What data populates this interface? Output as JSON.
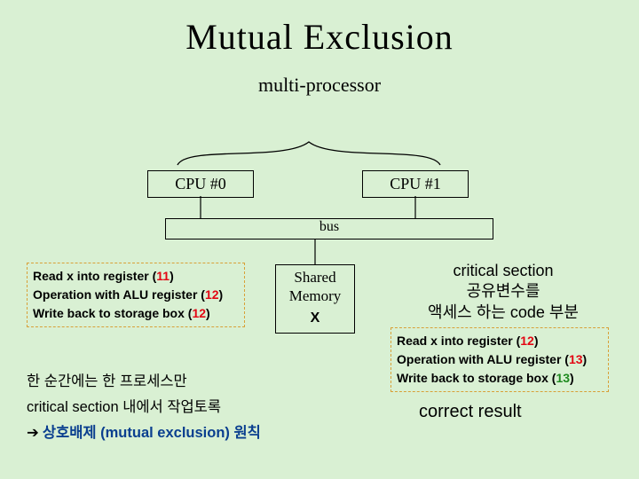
{
  "title": "Mutual Exclusion",
  "subtitle": "multi-processor",
  "cpu": {
    "c0": "CPU #0",
    "c1": "CPU #1"
  },
  "bus_label": "bus",
  "shared": {
    "l0": "Shared",
    "l1": "Memory",
    "var": "X"
  },
  "ops_left": {
    "l0_pre": "Read x into register (",
    "l0_num": "11",
    "l0_post": ")",
    "l1_pre": "Operation with ALU register (",
    "l1_num": "12",
    "l1_post": ")",
    "l2_pre": "Write back to storage box (",
    "l2_num": "12",
    "l2_post": ")"
  },
  "ops_right": {
    "l0_pre": "Read x into register (",
    "l0_num": "12",
    "l0_post": ")",
    "l1_pre": "Operation with ALU register (",
    "l1_num": "13",
    "l1_post": ")",
    "l2_pre": "Write back to storage box (",
    "l2_num": "13",
    "l2_post": ")"
  },
  "cs": {
    "title": "critical section",
    "l1": "공유변수를",
    "l2": "액세스 하는 code 부분"
  },
  "bottom": {
    "l0": "한 순간에는 한 프로세스만",
    "l1": "critical section 내에서 작업토록",
    "arrow": "➔",
    "principle": "상호배제 (mutual exclusion) 원칙"
  },
  "correct": "correct result"
}
